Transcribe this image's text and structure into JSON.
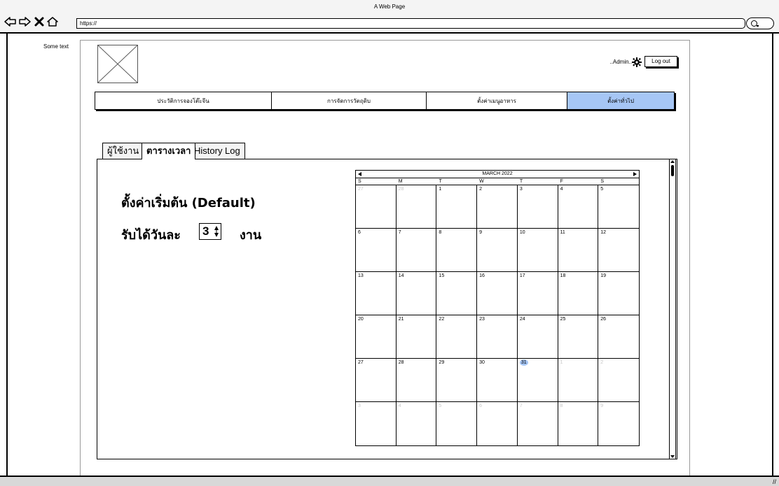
{
  "browser": {
    "title": "A Web Page",
    "url": "https://"
  },
  "side_text": "Some text",
  "header": {
    "admin_label": "..Admin..",
    "logout_label": "Log out"
  },
  "top_nav": [
    {
      "label": "ประวัติการจองโต๊ะจีน",
      "active": false
    },
    {
      "label": "การจัดการวัตถุดิบ",
      "active": false
    },
    {
      "label": "ตั้งค่าเมนูอาหาร",
      "active": false
    },
    {
      "label": "ตั้งค่าทั่วไป",
      "active": true
    }
  ],
  "tabs": [
    {
      "label": "ผู้ใช้งาน",
      "active": false
    },
    {
      "label": "ตารางเวลา",
      "active": true
    },
    {
      "label": "History Log",
      "active": false
    }
  ],
  "settings": {
    "heading": "ตั้งค่าเริ่มต้น (Default)",
    "per_day_label": "รับได้วันละ",
    "per_day_value": "3",
    "unit": "งาน"
  },
  "calendar": {
    "month_label": "MARCH 2022",
    "days_of_week": [
      "S",
      "M",
      "T",
      "W",
      "T",
      "F",
      "S"
    ],
    "cells": [
      {
        "day": "27",
        "outside": true
      },
      {
        "day": "28",
        "outside": true
      },
      {
        "day": "1"
      },
      {
        "day": "2"
      },
      {
        "day": "3"
      },
      {
        "day": "4"
      },
      {
        "day": "5"
      },
      {
        "day": "6"
      },
      {
        "day": "7"
      },
      {
        "day": "8"
      },
      {
        "day": "9"
      },
      {
        "day": "10"
      },
      {
        "day": "11"
      },
      {
        "day": "12"
      },
      {
        "day": "13"
      },
      {
        "day": "14"
      },
      {
        "day": "15"
      },
      {
        "day": "16"
      },
      {
        "day": "17"
      },
      {
        "day": "18"
      },
      {
        "day": "19"
      },
      {
        "day": "20"
      },
      {
        "day": "21"
      },
      {
        "day": "22"
      },
      {
        "day": "23"
      },
      {
        "day": "24"
      },
      {
        "day": "25"
      },
      {
        "day": "26"
      },
      {
        "day": "27"
      },
      {
        "day": "28"
      },
      {
        "day": "29"
      },
      {
        "day": "30"
      },
      {
        "day": "31",
        "today": true
      },
      {
        "day": "1",
        "outside": true
      },
      {
        "day": "2",
        "outside": true
      },
      {
        "day": "3",
        "outside": true
      },
      {
        "day": "4",
        "outside": true
      },
      {
        "day": "5",
        "outside": true
      },
      {
        "day": "6",
        "outside": true
      },
      {
        "day": "7",
        "outside": true
      },
      {
        "day": "8",
        "outside": true
      },
      {
        "day": "9",
        "outside": true
      }
    ]
  },
  "colors": {
    "accent": "#a6c6f5",
    "outside_day": "#c8c8c8"
  }
}
